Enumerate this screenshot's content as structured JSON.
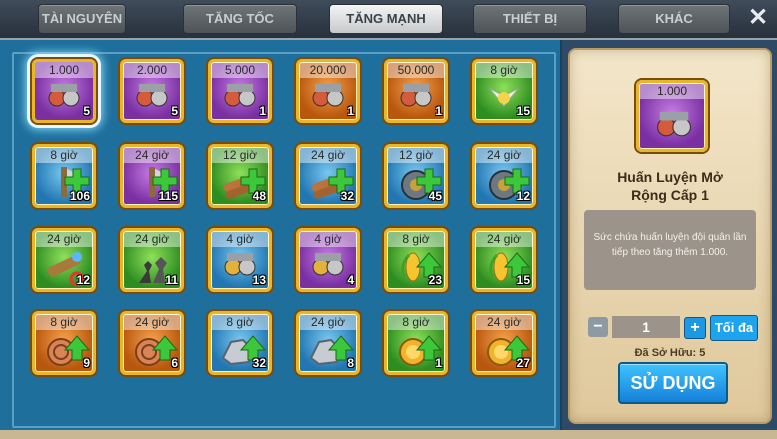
{
  "tabs": [
    {
      "label": "TÀI NGUYÊN"
    },
    {
      "label": "TĂNG TỐC"
    },
    {
      "label": "TĂNG MẠNH"
    },
    {
      "label": "THIẾT BỊ"
    },
    {
      "label": "KHÁC"
    }
  ],
  "close_label": "✕",
  "items": [
    {
      "time": "1.000",
      "count": "5"
    },
    {
      "time": "2.000",
      "count": "5"
    },
    {
      "time": "5.000",
      "count": "1"
    },
    {
      "time": "20.000",
      "count": "1"
    },
    {
      "time": "50.000",
      "count": "1"
    },
    {
      "time": "8 giờ",
      "count": "15"
    },
    {
      "time": "8 giờ",
      "count": "106"
    },
    {
      "time": "24 giờ",
      "count": "115"
    },
    {
      "time": "12 giờ",
      "count": "48"
    },
    {
      "time": "24 giờ",
      "count": "32"
    },
    {
      "time": "12 giờ",
      "count": "45"
    },
    {
      "time": "24 giờ",
      "count": "12"
    },
    {
      "time": "24 giờ",
      "count": "12"
    },
    {
      "time": "24 giờ",
      "count": "11"
    },
    {
      "time": "4 giờ",
      "count": "13"
    },
    {
      "time": "4 giờ",
      "count": "4"
    },
    {
      "time": "8 giờ",
      "count": "23"
    },
    {
      "time": "24 giờ",
      "count": "15"
    },
    {
      "time": "8 giờ",
      "count": "9"
    },
    {
      "time": "24 giờ",
      "count": "6"
    },
    {
      "time": "8 giờ",
      "count": "32"
    },
    {
      "time": "24 giờ",
      "count": "8"
    },
    {
      "time": "8 giờ",
      "count": "1"
    },
    {
      "time": "24 giờ",
      "count": "27"
    }
  ],
  "detail": {
    "preview_time": "1.000",
    "title_line1": "Huấn Luyện Mở",
    "title_line2": "Rộng Cấp 1",
    "description": "Sức chứa huấn luyện đội quân lần tiếp theo tăng thêm 1.000.",
    "quantity": "1",
    "max_label": "Tối đa",
    "owned_label": "Đã Sở Hữu: 5",
    "use_label": "SỬ DỤNG"
  },
  "colors": {
    "accent": "#1e98e0",
    "frame": "#e9b629"
  }
}
